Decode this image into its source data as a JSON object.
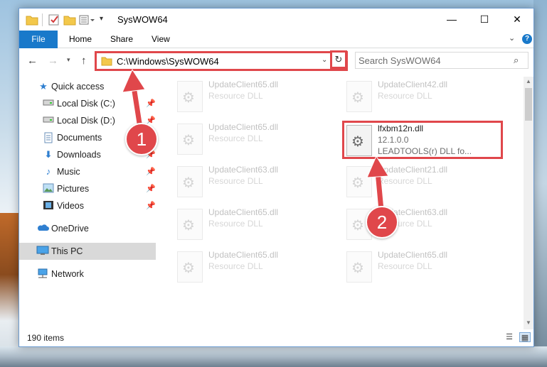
{
  "window": {
    "title": "SysWOW64",
    "min_glyph": "—",
    "max_glyph": "☐",
    "close_glyph": "✕"
  },
  "ribbon": {
    "tabs": [
      "File",
      "Home",
      "Share",
      "View"
    ],
    "help": "?"
  },
  "address": {
    "path": "C:\\Windows\\SysWOW64",
    "refresh_glyph": "↻"
  },
  "search": {
    "placeholder": "Search SysWOW64"
  },
  "sidebar": {
    "items": [
      {
        "label": "Quick access",
        "icon": "star-icon",
        "pinned": false
      },
      {
        "label": "Local Disk (C:)",
        "icon": "drive-icon",
        "pinned": true
      },
      {
        "label": "Local Disk (D:)",
        "icon": "drive-icon",
        "pinned": true
      },
      {
        "label": "Documents",
        "icon": "documents-icon",
        "pinned": true
      },
      {
        "label": "Downloads",
        "icon": "download-icon",
        "pinned": true
      },
      {
        "label": "Music",
        "icon": "music-icon",
        "pinned": true
      },
      {
        "label": "Pictures",
        "icon": "pictures-icon",
        "pinned": true
      },
      {
        "label": "Videos",
        "icon": "videos-icon",
        "pinned": true
      },
      {
        "label": "OneDrive",
        "icon": "cloud-icon",
        "pinned": false
      },
      {
        "label": "This PC",
        "icon": "computer-icon",
        "pinned": false,
        "selected": true
      },
      {
        "label": "Network",
        "icon": "network-icon",
        "pinned": false
      }
    ]
  },
  "files": [
    {
      "name": "UpdateClient65.dll",
      "type": "Resource DLL",
      "faded": true
    },
    {
      "name": "UpdateClient42.dll",
      "type": "Resource DLL",
      "faded": true
    },
    {
      "name": "UpdateClient65.dll",
      "type": "Resource DLL",
      "faded": true
    },
    {
      "name": "lfxbm12n.dll",
      "version": "12.1.0.0",
      "description": "LEADTOOLS(r) DLL fo...",
      "faded": false,
      "highlighted": true
    },
    {
      "name": "UpdateClient63.dll",
      "type": "Resource DLL",
      "faded": true
    },
    {
      "name": "UpdateClient21.dll",
      "type": "Resource DLL",
      "faded": true
    },
    {
      "name": "UpdateClient65.dll",
      "type": "Resource DLL",
      "faded": true
    },
    {
      "name": "UpdateClient63.dll",
      "type": "Resource DLL",
      "faded": true
    },
    {
      "name": "UpdateClient65.dll",
      "type": "Resource DLL",
      "faded": true
    },
    {
      "name": "UpdateClient65.dll",
      "type": "Resource DLL",
      "faded": true
    }
  ],
  "status": {
    "item_count": "190 items"
  },
  "annotations": {
    "step1": "1",
    "step2": "2",
    "color": "#e0474b"
  },
  "colors": {
    "accent": "#1979ca",
    "highlight_red": "#e0474b",
    "selected_bg": "#d9d9d9"
  }
}
